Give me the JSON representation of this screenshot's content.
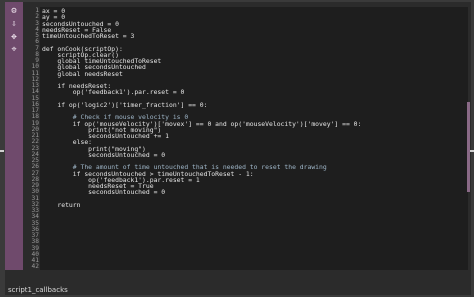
{
  "editor": {
    "status_label": "script1_callbacks",
    "gutter_icons": [
      "gear-icon",
      "arrow-down-icon",
      "move-icon",
      "split-icon"
    ],
    "gutter_glyphs": [
      "⚙",
      "⇩",
      "✥",
      "⌖"
    ],
    "lines": [
      {
        "n": "1",
        "t": "ax = 0",
        "c": "code"
      },
      {
        "n": "2",
        "t": "ay = 0",
        "c": "code"
      },
      {
        "n": "3",
        "t": "secondsUntouched = 0",
        "c": "code"
      },
      {
        "n": "4",
        "t": "needsReset = False",
        "c": "code"
      },
      {
        "n": "5",
        "t": "timeUntouchedToReset = 3",
        "c": "code"
      },
      {
        "n": "6",
        "t": "",
        "c": "code"
      },
      {
        "n": "7",
        "t": "def onCook(scriptOp):",
        "c": "code"
      },
      {
        "n": "8",
        "t": "    scriptOp.clear()",
        "c": "code"
      },
      {
        "n": "9",
        "t": "    global timeUntouchedToReset",
        "c": "code"
      },
      {
        "n": "10",
        "t": "    global secondsUntouched",
        "c": "code"
      },
      {
        "n": "11",
        "t": "    global needsReset",
        "c": "code"
      },
      {
        "n": "12",
        "t": "",
        "c": "code"
      },
      {
        "n": "13",
        "t": "    if needsReset:",
        "c": "code"
      },
      {
        "n": "14",
        "t": "        op('feedback1').par.reset = 0",
        "c": "code"
      },
      {
        "n": "15",
        "t": "",
        "c": "code"
      },
      {
        "n": "16",
        "t": "    if op('logic2')['timer_fraction'] == 0:",
        "c": "code"
      },
      {
        "n": "17",
        "t": "",
        "c": "code"
      },
      {
        "n": "18",
        "t": "        # Check if mouse velocity is 0",
        "c": "cmt"
      },
      {
        "n": "19",
        "t": "        if op('mouseVelocity')['movex'] == 0 and op('mouseVelocity')['movey'] == 0:",
        "c": "code"
      },
      {
        "n": "20",
        "t": "            print(\"not moving\")",
        "c": "code"
      },
      {
        "n": "21",
        "t": "            secondsUntouched += 1",
        "c": "code"
      },
      {
        "n": "22",
        "t": "        else:",
        "c": "code"
      },
      {
        "n": "23",
        "t": "            print(\"moving\")",
        "c": "code"
      },
      {
        "n": "24",
        "t": "            secondsUntouched = 0",
        "c": "code"
      },
      {
        "n": "25",
        "t": "",
        "c": "code"
      },
      {
        "n": "26",
        "t": "        # The amount of time untouched that is needed to reset the drawing",
        "c": "cmt"
      },
      {
        "n": "27",
        "t": "        if secondsUntouched > timeUntouchedToReset - 1:",
        "c": "code"
      },
      {
        "n": "28",
        "t": "            op('feedback1').par.reset = 1",
        "c": "code"
      },
      {
        "n": "29",
        "t": "            needsReset = True",
        "c": "code"
      },
      {
        "n": "30",
        "t": "            secondsUntouched = 0",
        "c": "code"
      },
      {
        "n": "31",
        "t": "",
        "c": "code"
      },
      {
        "n": "32",
        "t": "    return",
        "c": "code"
      },
      {
        "n": "33",
        "t": "",
        "c": "code"
      },
      {
        "n": "34",
        "t": "",
        "c": "code"
      },
      {
        "n": "35",
        "t": "",
        "c": "code"
      },
      {
        "n": "36",
        "t": "",
        "c": "code"
      },
      {
        "n": "37",
        "t": "",
        "c": "code"
      },
      {
        "n": "38",
        "t": "",
        "c": "code"
      },
      {
        "n": "39",
        "t": "",
        "c": "code"
      },
      {
        "n": "40",
        "t": "",
        "c": "code"
      },
      {
        "n": "41",
        "t": "",
        "c": "code"
      },
      {
        "n": "42",
        "t": "",
        "c": "code"
      }
    ]
  }
}
